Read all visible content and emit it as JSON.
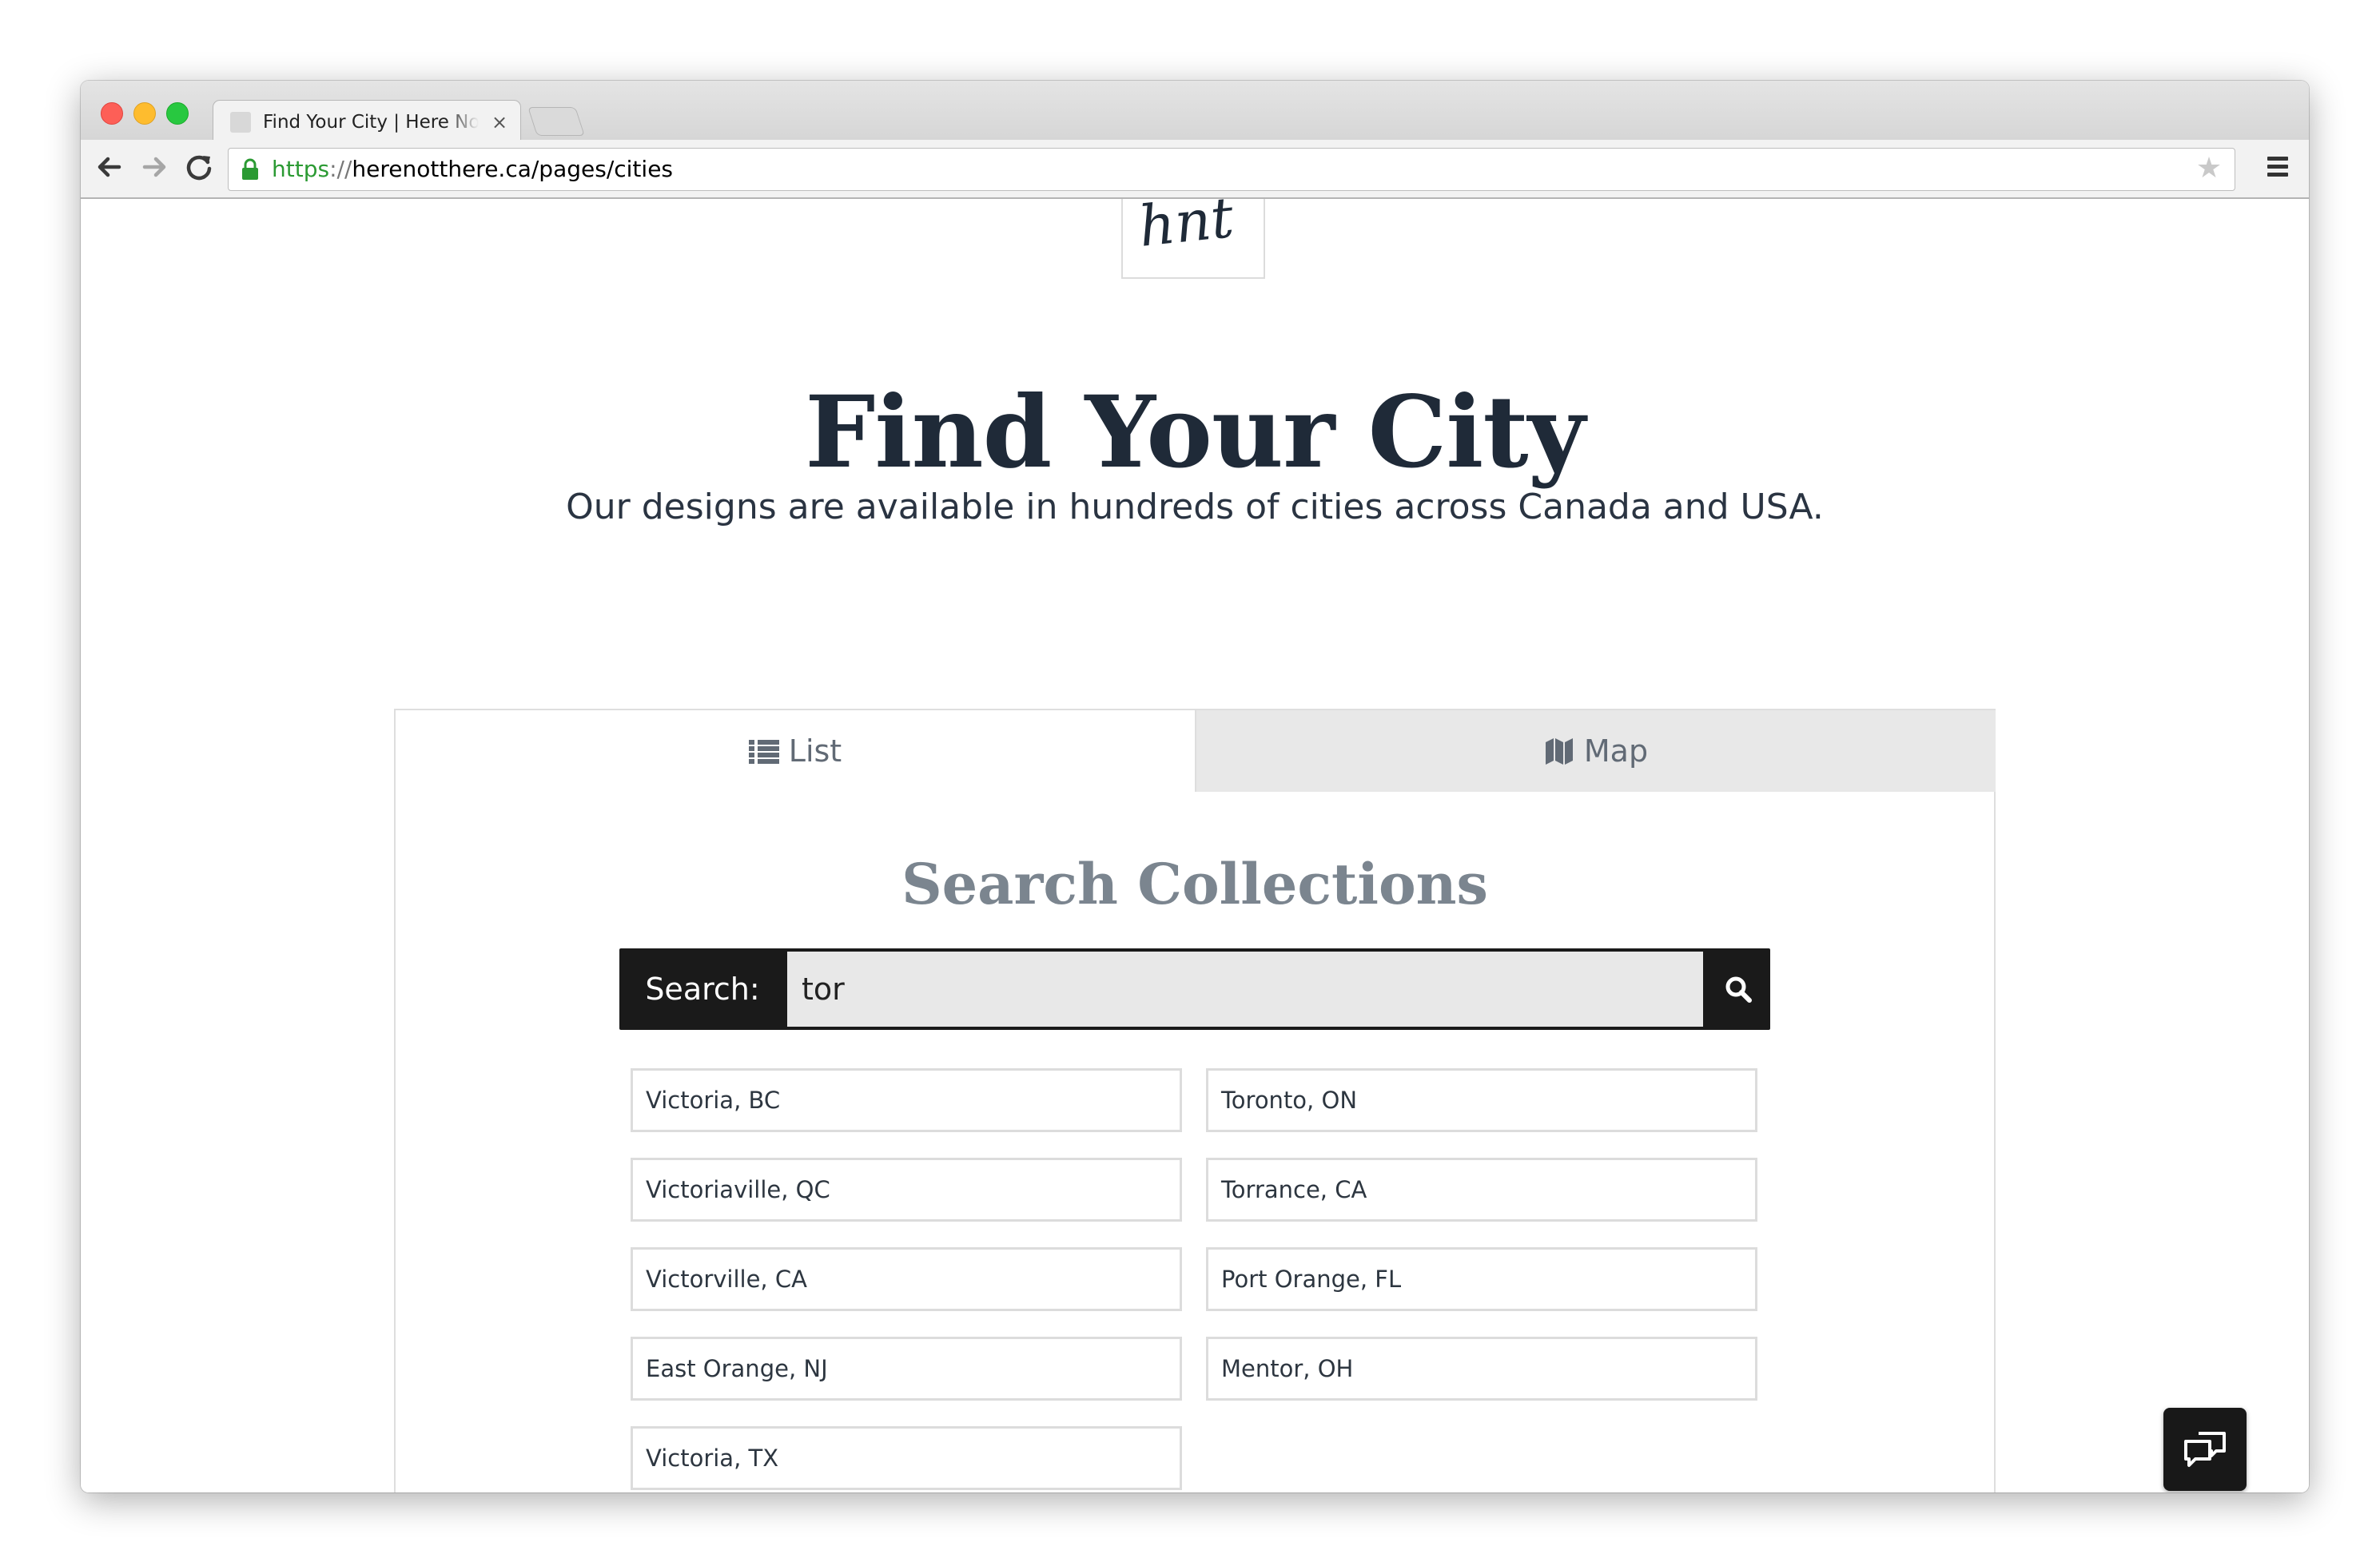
{
  "browser": {
    "tab_title": "Find Your City | Here Not There",
    "url_scheme": "https",
    "url_separator": "://",
    "url_rest": "herenotthere.ca/pages/cities",
    "icons": [
      "lock-icon",
      "star-icon",
      "menu-icon",
      "back-icon",
      "forward-icon",
      "reload-icon"
    ]
  },
  "header": {
    "logo_text": "hnt",
    "title": "Find Your City",
    "subtitle": "Our designs are available in hundreds of cities across Canada and USA."
  },
  "tabs": {
    "list_label": "List",
    "map_label": "Map",
    "active": "List"
  },
  "search": {
    "heading": "Search Collections",
    "label": "Search:",
    "value": "tor"
  },
  "results": [
    "Victoria, BC",
    "Toronto, ON",
    "Victoriaville, QC",
    "Torrance, CA",
    "Victorville, CA",
    "Port Orange, FL",
    "East Orange, NJ",
    "Mentor, OH",
    "Victoria, TX"
  ],
  "colors": {
    "title": "#1f2a38",
    "section_heading": "#7b858f",
    "search_bar": "#1a1a1a",
    "secure_green": "#2b9a33"
  }
}
